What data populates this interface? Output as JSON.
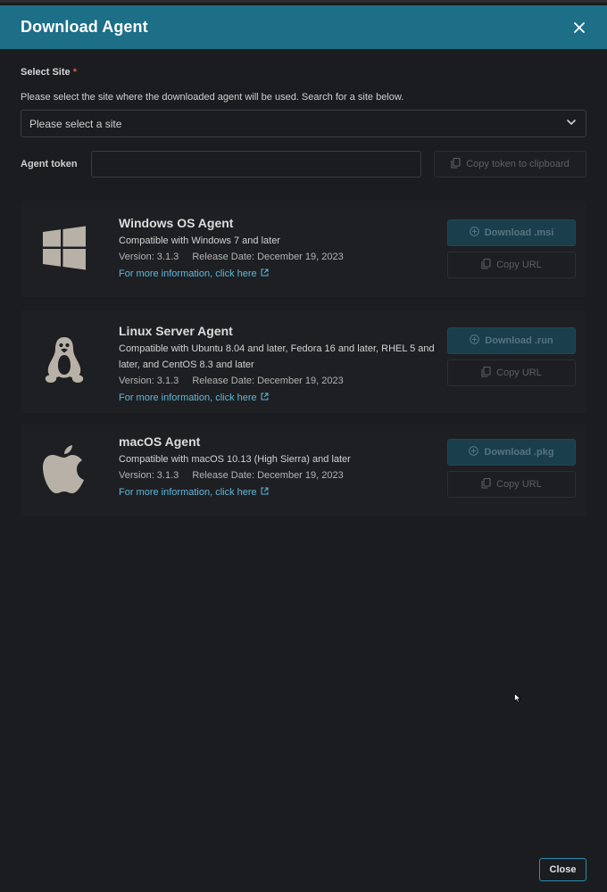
{
  "dialog": {
    "title": "Download Agent"
  },
  "site": {
    "label": "Select Site",
    "required_mark": "*",
    "help": "Please select the site where the downloaded agent will be used. Search for a site below.",
    "placeholder": "Please select a site"
  },
  "token": {
    "label": "Agent token",
    "value": "",
    "copy_label": "Copy token to clipboard"
  },
  "agents": [
    {
      "title": "Windows OS Agent",
      "compat": "Compatible with Windows 7 and later",
      "version": "Version: 3.1.3",
      "release": "Release Date: December 19, 2023",
      "link": "For more information, click here",
      "download": "Download .msi",
      "copy": "Copy URL",
      "logo": "windows-logo"
    },
    {
      "title": "Linux Server Agent",
      "compat": "Compatible with Ubuntu 8.04 and later, Fedora 16 and later, RHEL 5 and later, and CentOS 8.3 and later",
      "version": "Version: 3.1.3",
      "release": "Release Date: December 19, 2023",
      "link": "For more information, click here",
      "download": "Download .run",
      "copy": "Copy URL",
      "logo": "linux-tux-logo"
    },
    {
      "title": "macOS Agent",
      "compat": "Compatible with macOS 10.13 (High Sierra) and later",
      "version": "Version: 3.1.3",
      "release": "Release Date: December 19, 2023",
      "link": "For more information, click here",
      "download": "Download .pkg",
      "copy": "Copy URL",
      "logo": "apple-logo"
    }
  ],
  "footer": {
    "close_label": "Close"
  },
  "colors": {
    "header": "#1d6e87",
    "background": "#1b1c1f",
    "link": "#5fb8dd",
    "required": "#e0504b"
  }
}
